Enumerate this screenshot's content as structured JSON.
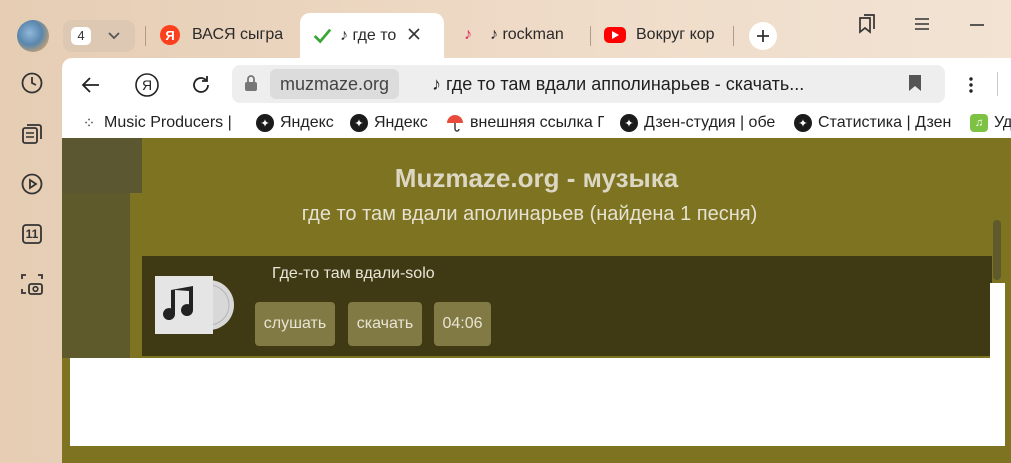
{
  "tabs": {
    "count": "4",
    "items": [
      {
        "label": "ВАСЯ сыгра",
        "favicon": "yandex-icon"
      },
      {
        "label": "♪ где то",
        "favicon": "check-icon"
      },
      {
        "label": "♪ rockman",
        "favicon": "music-note-icon"
      },
      {
        "label": "Вокруг кор",
        "favicon": "youtube-icon"
      }
    ]
  },
  "address": {
    "domain": "muzmaze.org",
    "title": "♪ где то там вдали апполинарьев - скачать..."
  },
  "bookmarks": [
    "Music Producers |",
    "Яндекс",
    "Яндекс",
    "внешняя ссылка Г",
    "Дзен-студия | обе",
    "Статистика | Дзен",
    "Уд"
  ],
  "rail": {
    "counter": "11"
  },
  "page": {
    "title": "Muzmaze.org - музыка",
    "subtitle": "где то там вдали аполинарьев (найдена 1 песня)",
    "result": {
      "song": "Где-то там вдали-solo",
      "listen": "слушать",
      "download": "скачать",
      "duration": "04:06"
    }
  },
  "colors": {
    "page_bg": "#7d7321",
    "result_bg": "#403a14",
    "button_bg": "#827a44"
  }
}
